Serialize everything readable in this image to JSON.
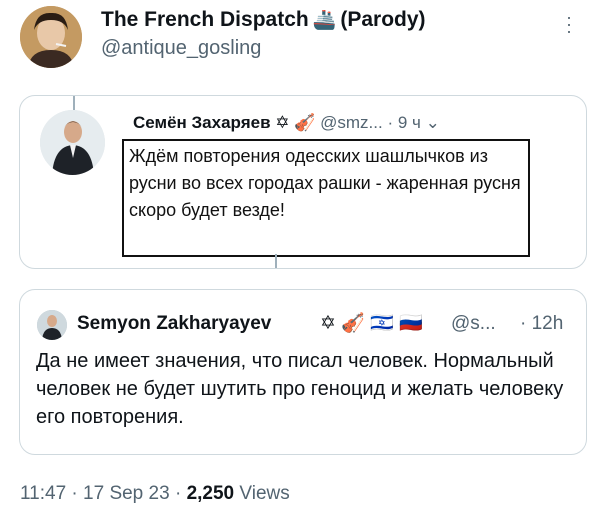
{
  "header": {
    "name": "The French Dispatch",
    "name_emoji": "🚢",
    "name_suffix": "(Parody)",
    "handle": "@antique_gosling",
    "more_icon": "more-icon"
  },
  "screenshot": {
    "author_name": "Семён Захаряев",
    "badges": "✡ 🎻",
    "handle": "@smz...",
    "time": "· 9 ч",
    "text": "Ждём повторения одесских шашлычков из русни во всех городах рашки - жаренная русня скоро будет везде!"
  },
  "quote": {
    "name": "Semyon Zakharyayev",
    "emojis": "✡ 🎻 🇮🇱 🇷🇺",
    "handle": "@s...",
    "time": "· 12h",
    "text": "Да не имеет значения, что писал человек. Нормальный человек не будет шутить про геноцид и желать человеку его повторения."
  },
  "footer": {
    "time": "11:47",
    "date": "17 Sep 23",
    "views_count": "2,250",
    "views_label": "Views"
  }
}
